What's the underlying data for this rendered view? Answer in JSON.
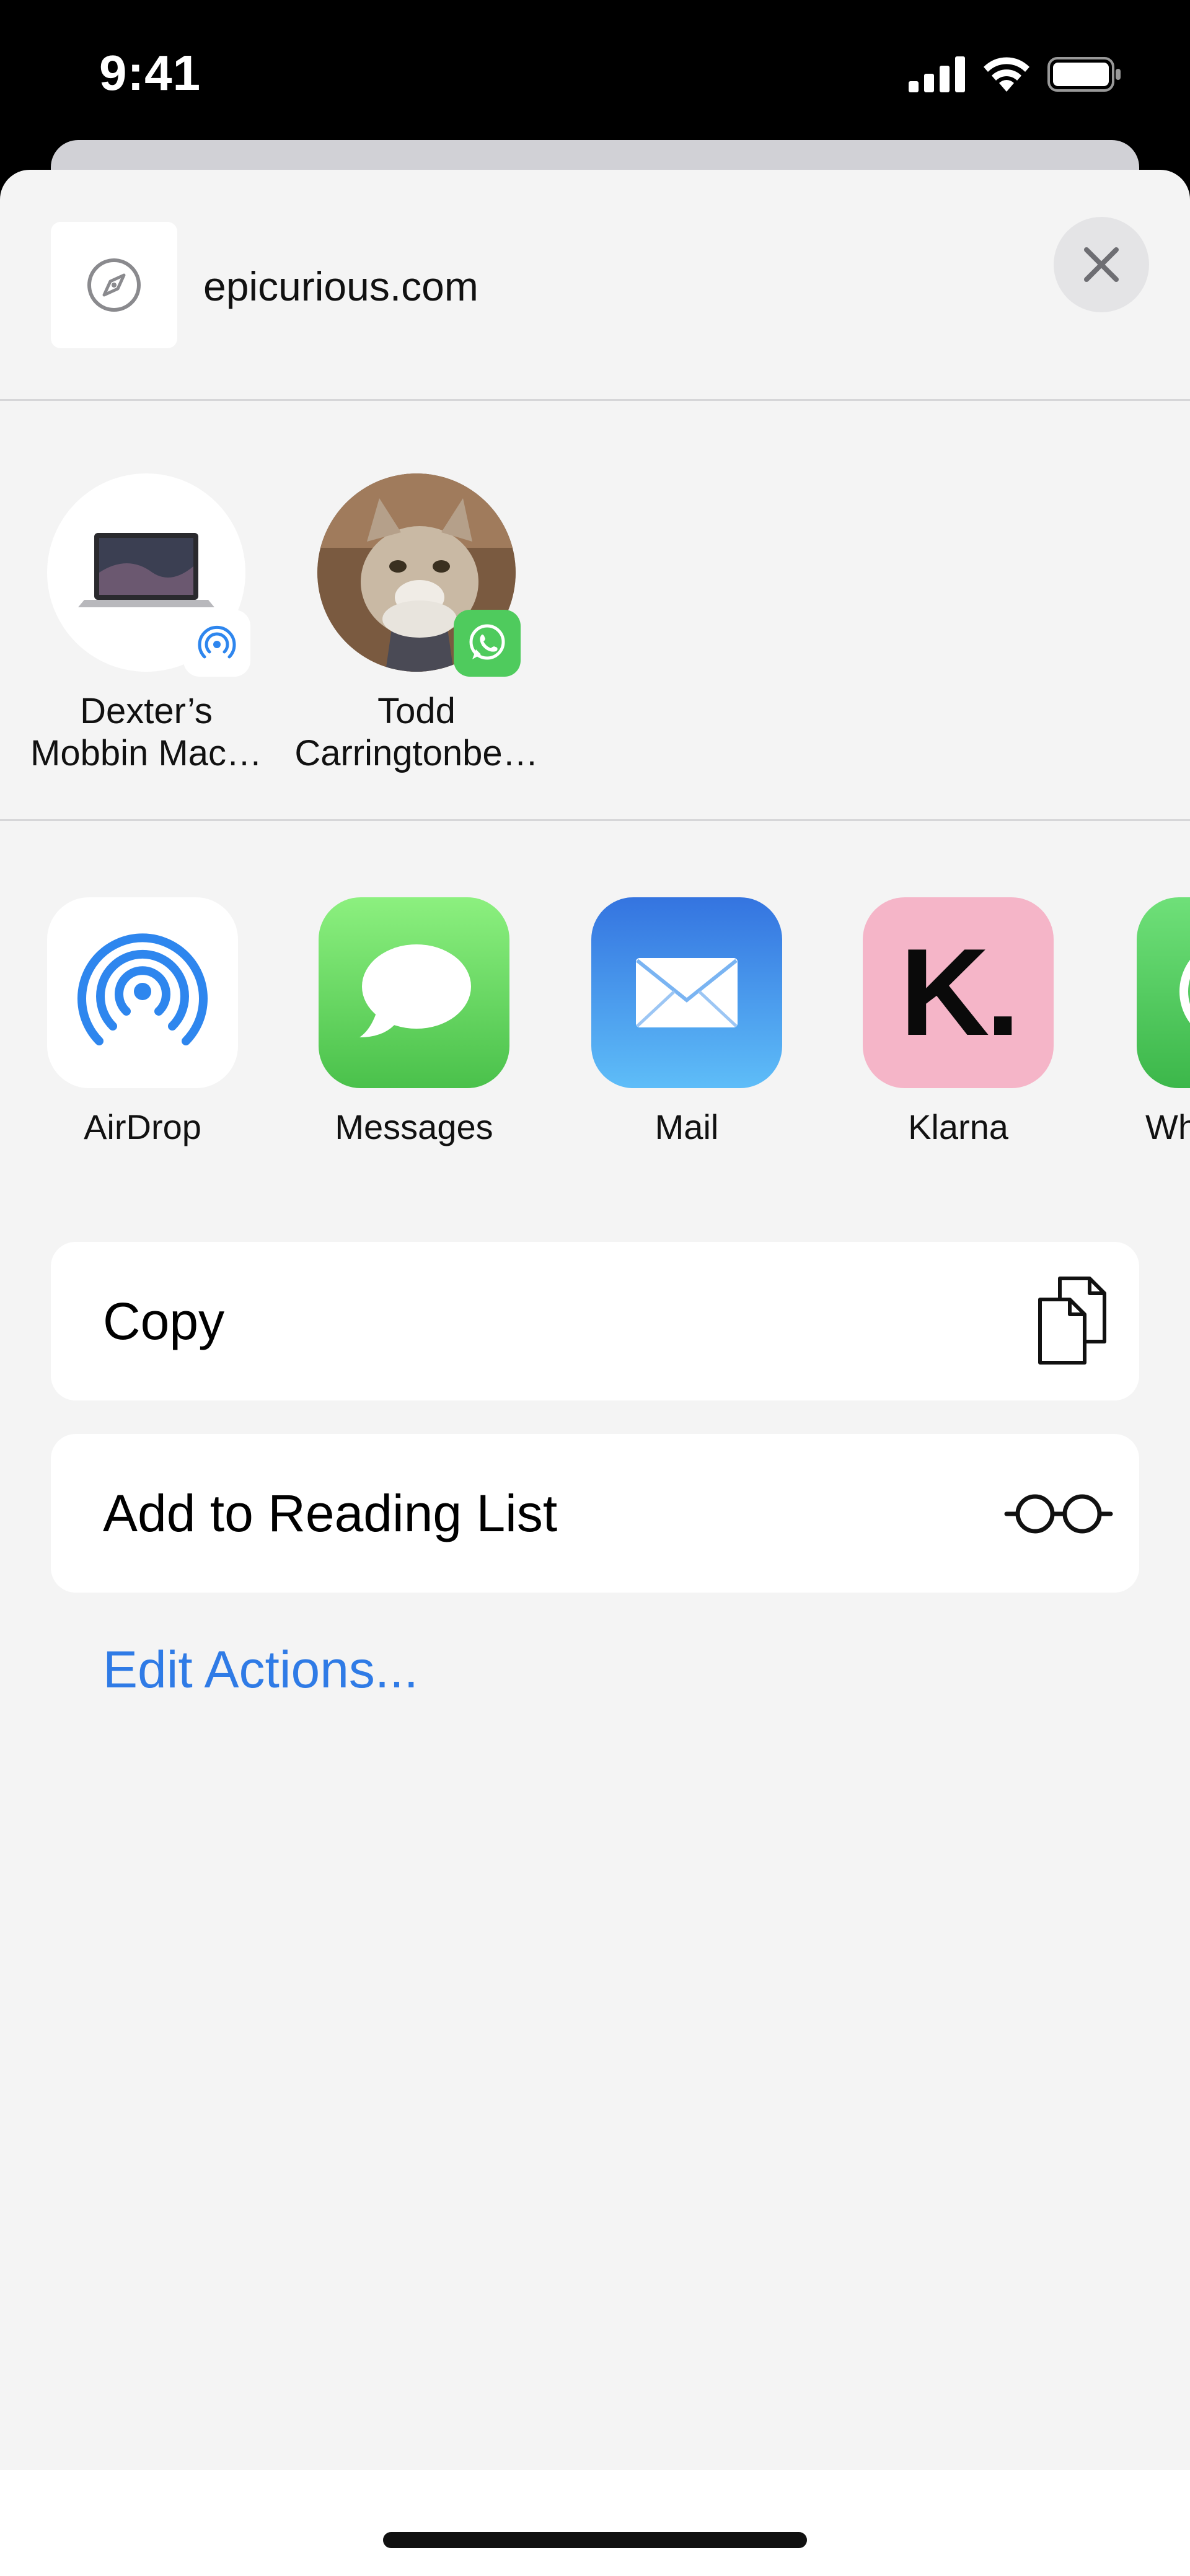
{
  "status_bar": {
    "time": "9:41",
    "icons": [
      "cellular-signal-icon",
      "wifi-icon",
      "battery-icon"
    ]
  },
  "share_header": {
    "site_icon": "compass-icon",
    "title": "epicurious.com",
    "close_icon": "close-icon"
  },
  "people": [
    {
      "name_line1": "Dexter’s",
      "name_line2": "Mobbin Mac…",
      "avatar": "macbook-image",
      "badge": "airdrop-icon"
    },
    {
      "name_line1": "Todd",
      "name_line2": "Carringtonbe…",
      "avatar": "cat-photo",
      "badge": "whatsapp-icon"
    }
  ],
  "apps": [
    {
      "label": "AirDrop",
      "icon": "airdrop-icon"
    },
    {
      "label": "Messages",
      "icon": "messages-icon"
    },
    {
      "label": "Mail",
      "icon": "mail-icon"
    },
    {
      "label": "Klarna",
      "icon": "klarna-icon",
      "glyph": "K."
    },
    {
      "label": "Wh",
      "icon": "whatsapp-icon"
    }
  ],
  "actions": [
    {
      "label": "Copy",
      "icon": "copy-icon"
    },
    {
      "label": "Add to Reading List",
      "icon": "glasses-icon"
    }
  ],
  "edit_actions": "Edit Actions...",
  "colors": {
    "accent": "#2f7be6",
    "airdrop_blue": "#2e86ee",
    "messages_green": "#5ed660",
    "mail_blue": "#3d8df3",
    "klarna_pink": "#f5b5c8",
    "whatsapp_green": "#4fcb5d",
    "sheet_background": "#f4f4f4"
  }
}
